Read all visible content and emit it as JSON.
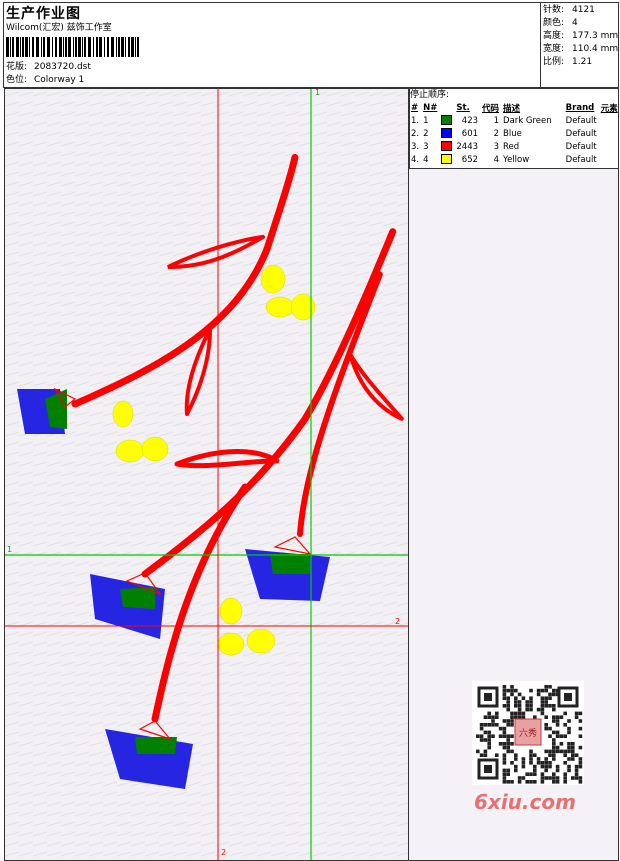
{
  "header": {
    "title": "生产作业图",
    "studio": "Wilcom(汇宏) 兹饰工作室",
    "design_label": "花版:",
    "design_value": "2083720.dst",
    "colorway_label": "色位:",
    "colorway_value": "Colorway 1"
  },
  "stats": {
    "stitches_label": "针数:",
    "stitches_value": "4121",
    "colors_label": "颜色:",
    "colors_value": "4",
    "height_label": "高度:",
    "height_value": "177.3 mm",
    "width_label": "宽度:",
    "width_value": "110.4 mm",
    "scale_label": "比例:",
    "scale_value": "1.21"
  },
  "stop_sequence": {
    "heading": "停止顺序:",
    "columns": [
      "#",
      "N#",
      "St.",
      "代码",
      "描述",
      "Brand",
      "元素"
    ],
    "rows": [
      {
        "index": "1.",
        "n": "1",
        "color": "#008000",
        "st": "423",
        "code": "1",
        "desc": "Dark Green",
        "brand": "Default"
      },
      {
        "index": "2.",
        "n": "2",
        "color": "#0000ff",
        "st": "601",
        "code": "2",
        "desc": "Blue",
        "brand": "Default"
      },
      {
        "index": "3.",
        "n": "3",
        "color": "#ff0000",
        "st": "2443",
        "code": "3",
        "desc": "Red",
        "brand": "Default"
      },
      {
        "index": "4.",
        "n": "4",
        "color": "#ffff00",
        "st": "652",
        "code": "4",
        "desc": "Yellow",
        "brand": "Default"
      }
    ]
  },
  "guides": {
    "green_v": "1",
    "green_h": "1",
    "red_h": "2",
    "red_v": "2"
  },
  "watermark": {
    "site": "6xiu.com",
    "seal": "六秀"
  },
  "colors": {
    "red": "#ff0000",
    "blue": "#0000ff",
    "green": "#008000",
    "yellow": "#ffff00",
    "guide_green": "#00cc00",
    "guide_red": "#ff0000"
  }
}
